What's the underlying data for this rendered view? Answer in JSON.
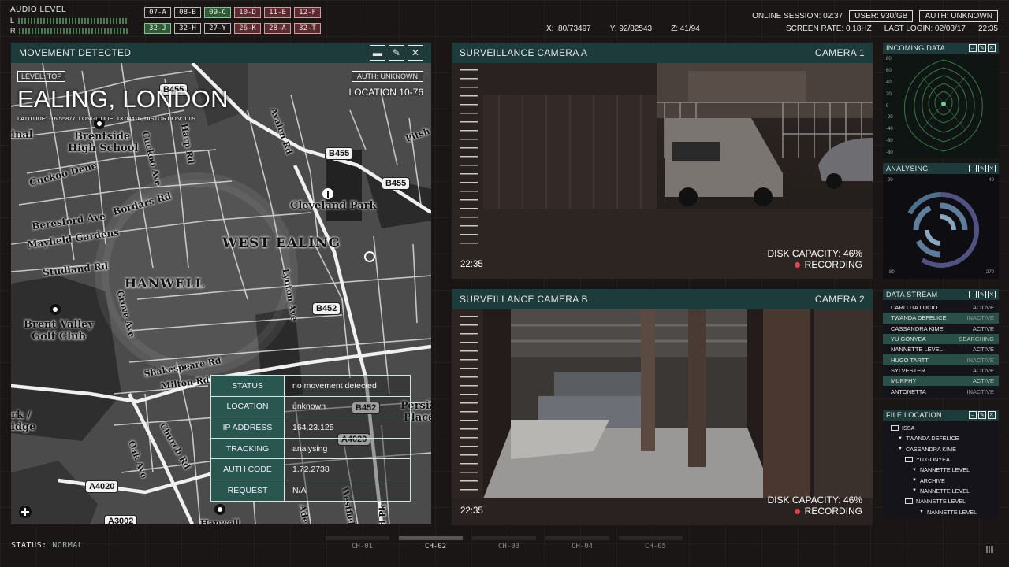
{
  "audio": {
    "title": "AUDIO LEVEL",
    "left": "L",
    "right": "R"
  },
  "codes": [
    {
      "label": "07-A",
      "style": "plain"
    },
    {
      "label": "08-B",
      "style": "plain"
    },
    {
      "label": "09-C",
      "style": "green"
    },
    {
      "label": "10-D",
      "style": "red"
    },
    {
      "label": "11-E",
      "style": "red"
    },
    {
      "label": "12-F",
      "style": "red"
    },
    {
      "label": "32-J",
      "style": "green"
    },
    {
      "label": "32-H",
      "style": "plain"
    },
    {
      "label": "27-Y",
      "style": "plain"
    },
    {
      "label": "26-K",
      "style": "red"
    },
    {
      "label": "28-A",
      "style": "red"
    },
    {
      "label": "32-T",
      "style": "red"
    }
  ],
  "coords": {
    "x": "X: .80/73497",
    "y": "Y: 92/82543",
    "z": "Z: 41/94"
  },
  "session": {
    "online": "ONLINE SESSION: 02:37",
    "user": "USER: 930/GB",
    "auth": "AUTH: UNKNOWN",
    "screen_rate": "SCREEN RATE: 0.18HZ",
    "last_login": "LAST LOGIN: 02/03/17",
    "time": "22:35"
  },
  "movement": {
    "title": "MOVEMENT DETECTED",
    "buttons": {
      "minimize": "▬",
      "edit": "✎",
      "close": "✕"
    },
    "level": "LEVEL: TOP",
    "auth": "AUTH: UNKNOWN",
    "city": "EALING, LONDON",
    "latlon": "LATITUDE: -16.55877, LONGITUDE: 13.04416, DISTORTION: 1.09",
    "location": "LOCATION 10-76",
    "info": [
      {
        "key": "STATUS",
        "value": "no movement detected"
      },
      {
        "key": "LOCATION",
        "value": "unknown"
      },
      {
        "key": "IP ADDRESS",
        "value": "164.23.125"
      },
      {
        "key": "TRACKING",
        "value": "analysing"
      },
      {
        "key": "AUTH CODE",
        "value": "1.72.2738"
      },
      {
        "key": "REQUEST",
        "value": "N/A"
      }
    ]
  },
  "map_labels": {
    "inal": "inal",
    "brentside": "Brentside",
    "high_school": "High School",
    "cuckoo_dene": "Cuckoo Dene",
    "beresford": "Beresford Ave",
    "mayfield": "Mayfield Gardens",
    "studland": "Studland Rd",
    "bordars": "Bordars Rd",
    "cuckoo_ave": "Cuckoo Ave",
    "harp": "Harp Rd",
    "avalon": "Avalon Rd",
    "pitsh": "Pitsh",
    "cleveland": "Cleveland Park",
    "west_ealing": "WEST EALING",
    "hanwell": "HANWELL",
    "grove": "Grove Ave",
    "lynton": "Lynton Ave",
    "brent_valley": "Brent Valley",
    "golf": "Golf Club",
    "shakespeare": "Shakespeare Rd",
    "milton": "Milton Rd",
    "church": "Church Rd",
    "oak": "Oak Ave",
    "rk": "rk /",
    "idge": "idge",
    "persian": "Persian",
    "place": "Place",
    "hanwell_b": "Hanwell",
    "ade": "Ade",
    "westfield": "Westfield",
    "d_pk": "d Pk",
    "b455a": "B455",
    "b455b": "B455",
    "b455c": "B455",
    "b452a": "B452",
    "b452b": "B452",
    "a4020a": "A4020",
    "a4020b": "A4020",
    "a3002": "A3002"
  },
  "camera_a": {
    "title": "SURVEILLANCE CAMERA A",
    "cam": "CAMERA 1",
    "time": "22:35",
    "disk": "DISK CAPACITY: 46%",
    "rec": "RECORDING"
  },
  "camera_b": {
    "title": "SURVEILLANCE CAMERA B",
    "cam": "CAMERA 2",
    "time": "22:35",
    "disk": "DISK CAPACITY: 46%",
    "rec": "RECORDING"
  },
  "incoming": {
    "title": "INCOMING DATA",
    "left_ticks": [
      "80",
      "60",
      "40",
      "20",
      "0",
      "-20",
      "-40",
      "-60",
      "-80"
    ]
  },
  "analysing": {
    "title": "ANALYSING",
    "tl": "20",
    "tr": "40",
    "bl": "-80",
    "br": "-270"
  },
  "data_stream": {
    "title": "DATA STREAM",
    "rows": [
      {
        "name": "CARLOTA LUCIO",
        "status": "ACTIVE",
        "hl": false
      },
      {
        "name": "TWANDA DEFELICE",
        "status": "INACTIVE",
        "hl": true
      },
      {
        "name": "CASSANDRA KIME",
        "status": "ACTIVE",
        "hl": false
      },
      {
        "name": "YU GONYEA",
        "status": "SEARCHING",
        "hl": true
      },
      {
        "name": "NANNETTE LEVEL",
        "status": "ACTIVE",
        "hl": false
      },
      {
        "name": "HUGO TARTT",
        "status": "INACTIVE",
        "hl": true
      },
      {
        "name": "SYLVESTER",
        "status": "ACTIVE",
        "hl": false
      },
      {
        "name": "MURPHY",
        "status": "ACTIVE",
        "hl": true
      },
      {
        "name": "ANTONETTA",
        "status": "INACTIVE",
        "hl": false
      }
    ]
  },
  "file_location": {
    "title": "FILE LOCATION",
    "rows": [
      {
        "name": "ISSA",
        "type": "folder",
        "depth": 0
      },
      {
        "name": "TWANDA DEFELICE",
        "type": "arrow",
        "depth": 1
      },
      {
        "name": "CASSANDRA KIME",
        "type": "arrow",
        "depth": 1
      },
      {
        "name": "YU GONYEA",
        "type": "folder",
        "depth": 2
      },
      {
        "name": "NANNETTE LEVEL",
        "type": "arrow",
        "depth": 3
      },
      {
        "name": "ARCHIVE",
        "type": "arrow",
        "depth": 3
      },
      {
        "name": "NANNETTE LEVEL",
        "type": "arrow",
        "depth": 3
      },
      {
        "name": "NANNETTE LEVEL",
        "type": "folder",
        "depth": 2
      },
      {
        "name": "NANNETTE LEVEL",
        "type": "arrow",
        "depth": 4
      }
    ]
  },
  "status": {
    "label": "STATUS:",
    "value": "NORMAL"
  },
  "channels": [
    {
      "label": "CH-01",
      "active": false
    },
    {
      "label": "CH-02",
      "active": true
    },
    {
      "label": "CH-03",
      "active": false
    },
    {
      "label": "CH-04",
      "active": false
    },
    {
      "label": "CH-05",
      "active": false
    }
  ]
}
